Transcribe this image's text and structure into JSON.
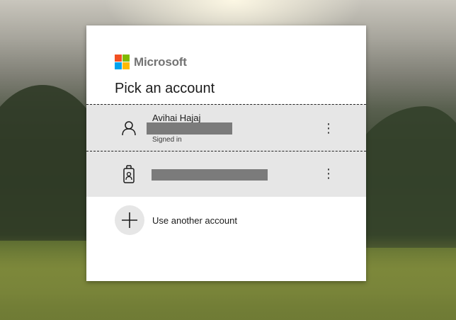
{
  "brand": {
    "name": "Microsoft",
    "colors": [
      "#f25022",
      "#7fba00",
      "#00a4ef",
      "#ffb900"
    ]
  },
  "dialog": {
    "title": "Pick an account"
  },
  "accounts": [
    {
      "name": "Avihai Hajaj",
      "status": "Signed in",
      "icon": "person-icon",
      "more": "⋮"
    },
    {
      "name": "",
      "status": "",
      "icon": "work-badge-icon",
      "more": "⋮"
    }
  ],
  "add_account": {
    "label": "Use another account",
    "icon": "plus-icon"
  }
}
